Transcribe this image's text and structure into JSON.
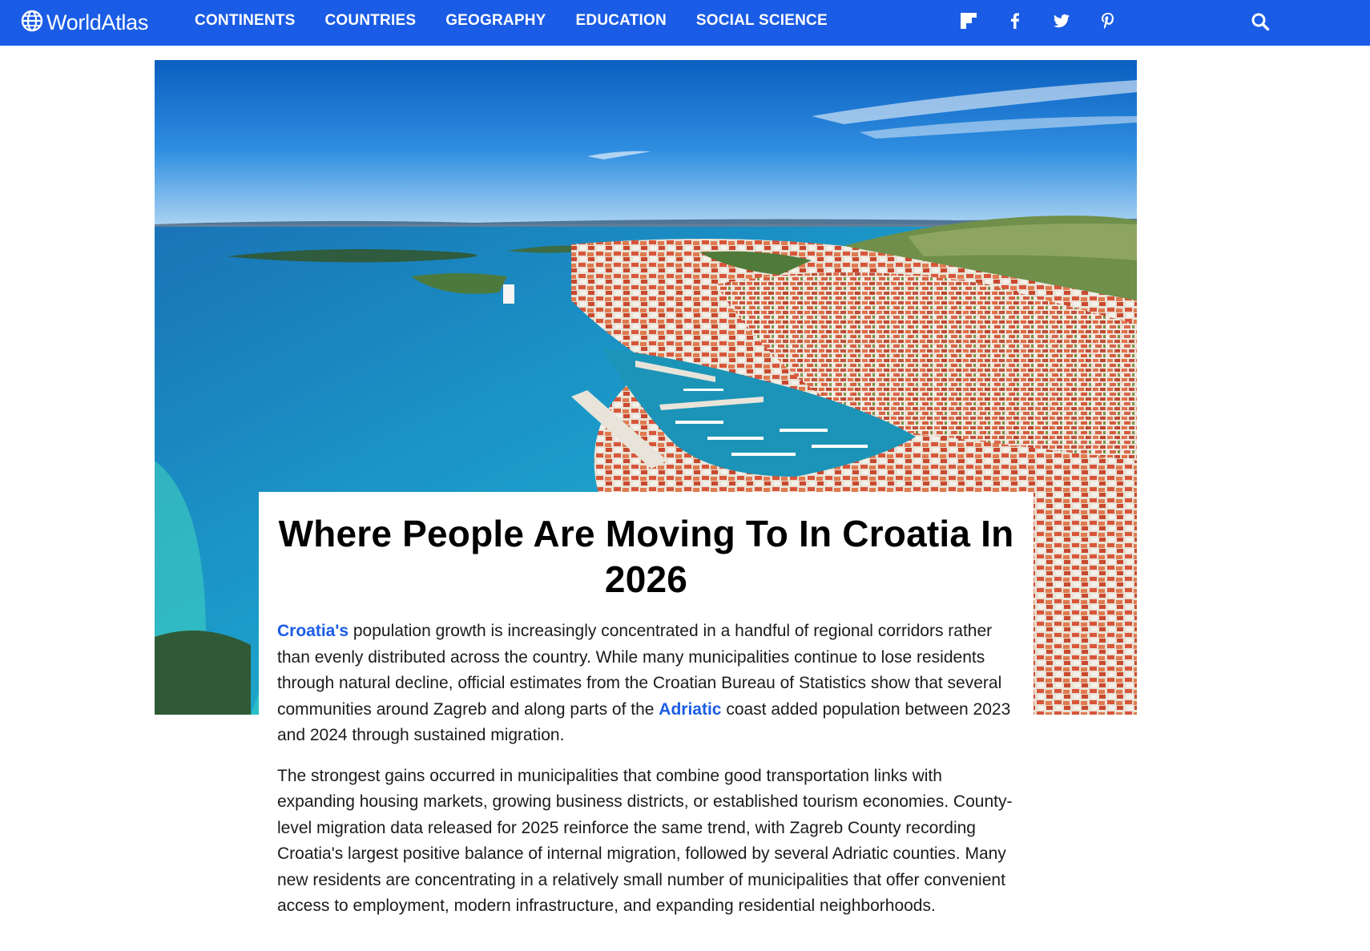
{
  "site": {
    "logo_text": "WorldAtlas",
    "logo_icon": "globe-icon",
    "brand_color": "#1a5ce5"
  },
  "nav": {
    "items": [
      {
        "label": "CONTINENTS"
      },
      {
        "label": "COUNTRIES"
      },
      {
        "label": "GEOGRAPHY"
      },
      {
        "label": "EDUCATION"
      },
      {
        "label": "SOCIAL SCIENCE"
      }
    ],
    "social_icons": [
      "flipboard-icon",
      "facebook-icon",
      "twitter-icon",
      "pinterest-icon"
    ],
    "search_icon": "search-icon"
  },
  "article": {
    "hero_image": "aerial-coastal-town-marina-croatia",
    "title": "Where People Are Moving To In Croatia In 2026",
    "paragraph1": {
      "link1": "Croatia's",
      "text1": " population growth is increasingly concentrated in a handful of regional corridors rather than evenly distributed across the country. While many municipalities continue to lose residents through natural decline, official estimates from the Croatian Bureau of Statistics show that several communities around Zagreb and along parts of the ",
      "link2": "Adriatic",
      "text2": " coast added population between 2023 and 2024 through sustained migration."
    },
    "paragraph2": "The strongest gains occurred in municipalities that combine good transportation links with expanding housing markets, growing business districts, or established tourism economies. County-level migration data released for 2025 reinforce the same trend, with Zagreb County recording Croatia's largest positive balance of internal migration, followed by several Adriatic counties. Many new residents are concentrating in a relatively small number of municipalities that offer convenient access to employment, modern infrastructure, and expanding residential neighborhoods."
  }
}
